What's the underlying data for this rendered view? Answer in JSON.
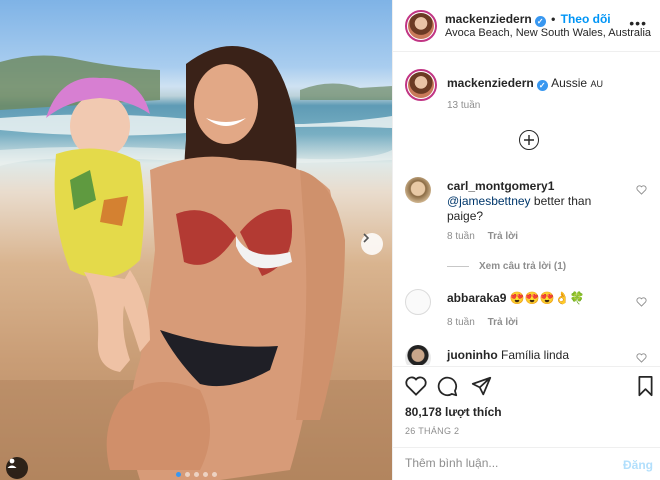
{
  "post": {
    "username": "mackenziedern",
    "follow_label": "Theo dõi",
    "location": "Avoca Beach, New South Wales, Australia",
    "caption_text": "Aussie",
    "caption_flag": "AU",
    "caption_time": "13 tuần",
    "likes": "80,178 lượt thích",
    "date": "26 THÁNG 2",
    "comment_placeholder": "Thêm bình luận...",
    "post_label": "Đăng"
  },
  "comments": [
    {
      "user": "carl_montgomery1",
      "mention": "@jamesbettney",
      "text": "better than paige?",
      "time": "8 tuần",
      "reply": "Trả lời"
    },
    {
      "user": "abbaraka9",
      "text": "😍😍😍👌🍀",
      "time": "8 tuần",
      "reply": "Trả lời"
    },
    {
      "user": "juoninho",
      "text": "Família linda"
    }
  ],
  "view_replies": "Xem câu trả lời (1)",
  "carousel": {
    "count": 5,
    "active": 0
  },
  "colors": {
    "link": "#0095f6",
    "muted": "#8e8e8e",
    "text": "#262626",
    "dot_active": "#3897f0"
  },
  "icons": [
    "heart-icon",
    "comment-icon",
    "share-icon",
    "bookmark-icon",
    "plus-circle-icon",
    "chevron-right-icon",
    "user-tag-icon",
    "verified-icon",
    "more-icon"
  ]
}
